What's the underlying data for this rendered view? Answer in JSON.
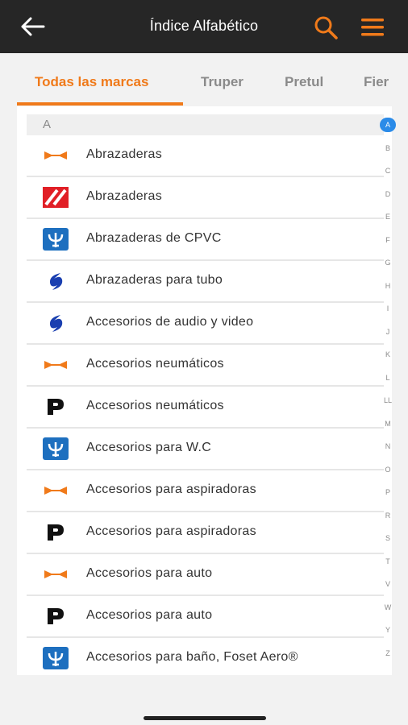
{
  "appbar": {
    "title": "Índice Alfabético",
    "back_icon": "arrow-left-icon",
    "search_icon": "search-icon",
    "menu_icon": "hamburger-menu-icon",
    "accent_color": "#f07a1a",
    "bar_color": "#262626"
  },
  "tabs": [
    {
      "label": "Todas las marcas",
      "active": true
    },
    {
      "label": "Truper",
      "active": false
    },
    {
      "label": "Pretul",
      "active": false
    },
    {
      "label": "Fier",
      "active": false
    }
  ],
  "section": {
    "header": "A"
  },
  "items": [
    {
      "label": "Abrazaderas",
      "brand_icon": "truper-logo-icon"
    },
    {
      "label": "Abrazaderas",
      "brand_icon": "fiero-logo-icon"
    },
    {
      "label": "Abrazaderas de CPVC",
      "brand_icon": "foset-logo-icon"
    },
    {
      "label": "Abrazaderas para tubo",
      "brand_icon": "volteck-logo-icon"
    },
    {
      "label": "Accesorios de audio y video",
      "brand_icon": "volteck-logo-icon"
    },
    {
      "label": "Accesorios neumáticos",
      "brand_icon": "truper-logo-icon"
    },
    {
      "label": "Accesorios neumáticos",
      "brand_icon": "pretul-logo-icon"
    },
    {
      "label": "Accesorios para W.C",
      "brand_icon": "foset-logo-icon"
    },
    {
      "label": "Accesorios para aspiradoras",
      "brand_icon": "truper-logo-icon"
    },
    {
      "label": "Accesorios para aspiradoras",
      "brand_icon": "pretul-logo-icon"
    },
    {
      "label": "Accesorios para auto",
      "brand_icon": "truper-logo-icon"
    },
    {
      "label": "Accesorios para auto",
      "brand_icon": "pretul-logo-icon"
    },
    {
      "label": "Accesorios para baño, Foset Aero®",
      "brand_icon": "foset-logo-icon"
    }
  ],
  "alphabet": [
    "A",
    "B",
    "C",
    "D",
    "E",
    "F",
    "G",
    "H",
    "I",
    "J",
    "K",
    "L",
    "LL",
    "M",
    "N",
    "O",
    "P",
    "R",
    "S",
    "T",
    "V",
    "W",
    "Y",
    "Z"
  ],
  "alphabet_active": "A",
  "alphabet_active_color": "#2b8be8"
}
